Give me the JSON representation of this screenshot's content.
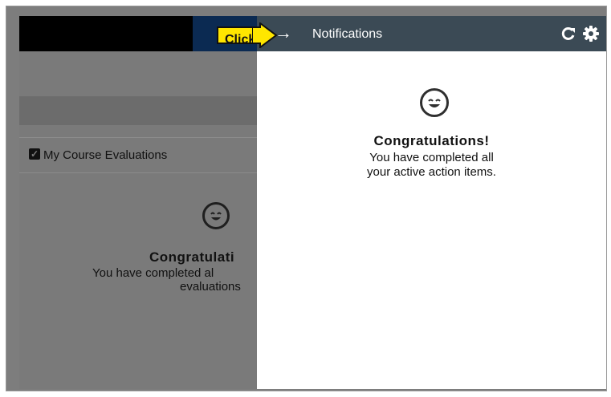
{
  "background_page": {
    "section_title": "My Course Evaluations",
    "congrats_title": "Congratulati",
    "message_line1": "You have completed al",
    "message_line2": "evaluations"
  },
  "panel": {
    "title": "Notifications",
    "congrats_title": "Congratulations!",
    "message_line1": "You have completed all",
    "message_line2": "your active action items."
  },
  "callout": {
    "label": "Click"
  },
  "icons": {
    "close_panel": "arrow-right-icon",
    "refresh": "refresh-icon",
    "settings": "gear-icon",
    "smiley": "smiley-icon",
    "checkbox": "checkbox-checked-icon"
  },
  "colors": {
    "panel_header": "#3b4a55",
    "overlay": "#7d7d7d",
    "callout": "#ffe600"
  }
}
